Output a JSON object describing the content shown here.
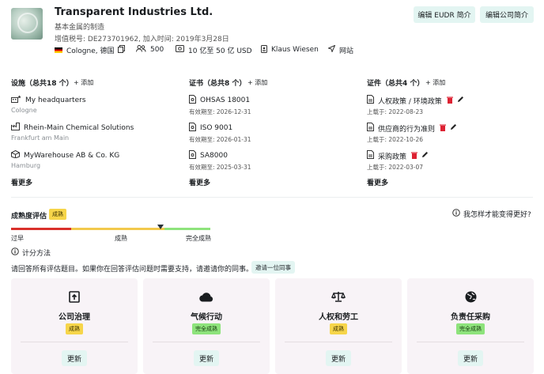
{
  "company": {
    "name": "Transparent Industries Ltd.",
    "industry": "基本金属的制造",
    "vat_line": "增值税号: DE273701962, 加入时间: 2019年3月28日",
    "location": "Cologne, 德国",
    "employees": "500",
    "revenue": "10 亿至 50 亿 USD",
    "contact": "Klaus Wiesen",
    "website": "网站"
  },
  "header_buttons": {
    "edit_eudr": "编辑 EUDR 简介",
    "edit_company": "编辑公司简介"
  },
  "facilities": {
    "title": "设施（总共18 个）",
    "add": "+ 添加",
    "more": "看更多",
    "items": [
      {
        "name": "My headquarters",
        "city": "Cologne",
        "icon": "headquarters-icon"
      },
      {
        "name": "Rhein-Main Chemical Solutions",
        "city": "Frankfurt am Main",
        "icon": "factory-icon"
      },
      {
        "name": "MyWarehouse AB & Co. KG",
        "city": "Hamburg",
        "icon": "warehouse-icon"
      }
    ]
  },
  "certificates": {
    "title": "证书（总共8 个）",
    "add": "+ 添加",
    "more": "看更多",
    "items": [
      {
        "name": "OHSAS 18001",
        "validity": "有效期至: 2026-12-31"
      },
      {
        "name": "ISO 9001",
        "validity": "有效期至: 2026-01-31"
      },
      {
        "name": "SA8000",
        "validity": "有效期至: 2025-03-31"
      }
    ]
  },
  "documents": {
    "title": "证件（总共4 个）",
    "add": "+ 添加",
    "more": "看更多",
    "items": [
      {
        "name": "人权政策 / 环境政策",
        "uploaded": "上载于: 2022-08-23"
      },
      {
        "name": "供应商的行为准则",
        "uploaded": "上载于: 2022-10-26"
      },
      {
        "name": "采购政策",
        "uploaded": "上载于: 2022-03-07"
      }
    ]
  },
  "maturity": {
    "title": "成熟度评估",
    "badge": "成熟",
    "help": "我怎样才能变得更好?",
    "scale": [
      "过早",
      "成熟",
      "完全成熟"
    ],
    "score_fraction": 0.75,
    "colors": {
      "early": "#d9302b",
      "mature": "#f2c94c",
      "full": "#8ee37c",
      "marker": "#2b3338"
    },
    "method": "计分方法",
    "instruction": "请回答所有评估题目。如果你在回答评估问题时需要支持，请邀请你的同事。",
    "invite": "邀请一位同事"
  },
  "cards": [
    {
      "title": "公司治理",
      "badge": "成熟",
      "badge_type": "y",
      "icon": "upload-box-icon",
      "button": "更新"
    },
    {
      "title": "气候行动",
      "badge": "完全成熟",
      "badge_type": "g",
      "icon": "cloud-icon",
      "button": "更新"
    },
    {
      "title": "人权和劳工",
      "badge": "成熟",
      "badge_type": "y",
      "icon": "scales-icon",
      "button": "更新"
    },
    {
      "title": "负责任采购",
      "badge": "完全成熟",
      "badge_type": "g",
      "icon": "globe-icon",
      "button": "更新"
    }
  ]
}
